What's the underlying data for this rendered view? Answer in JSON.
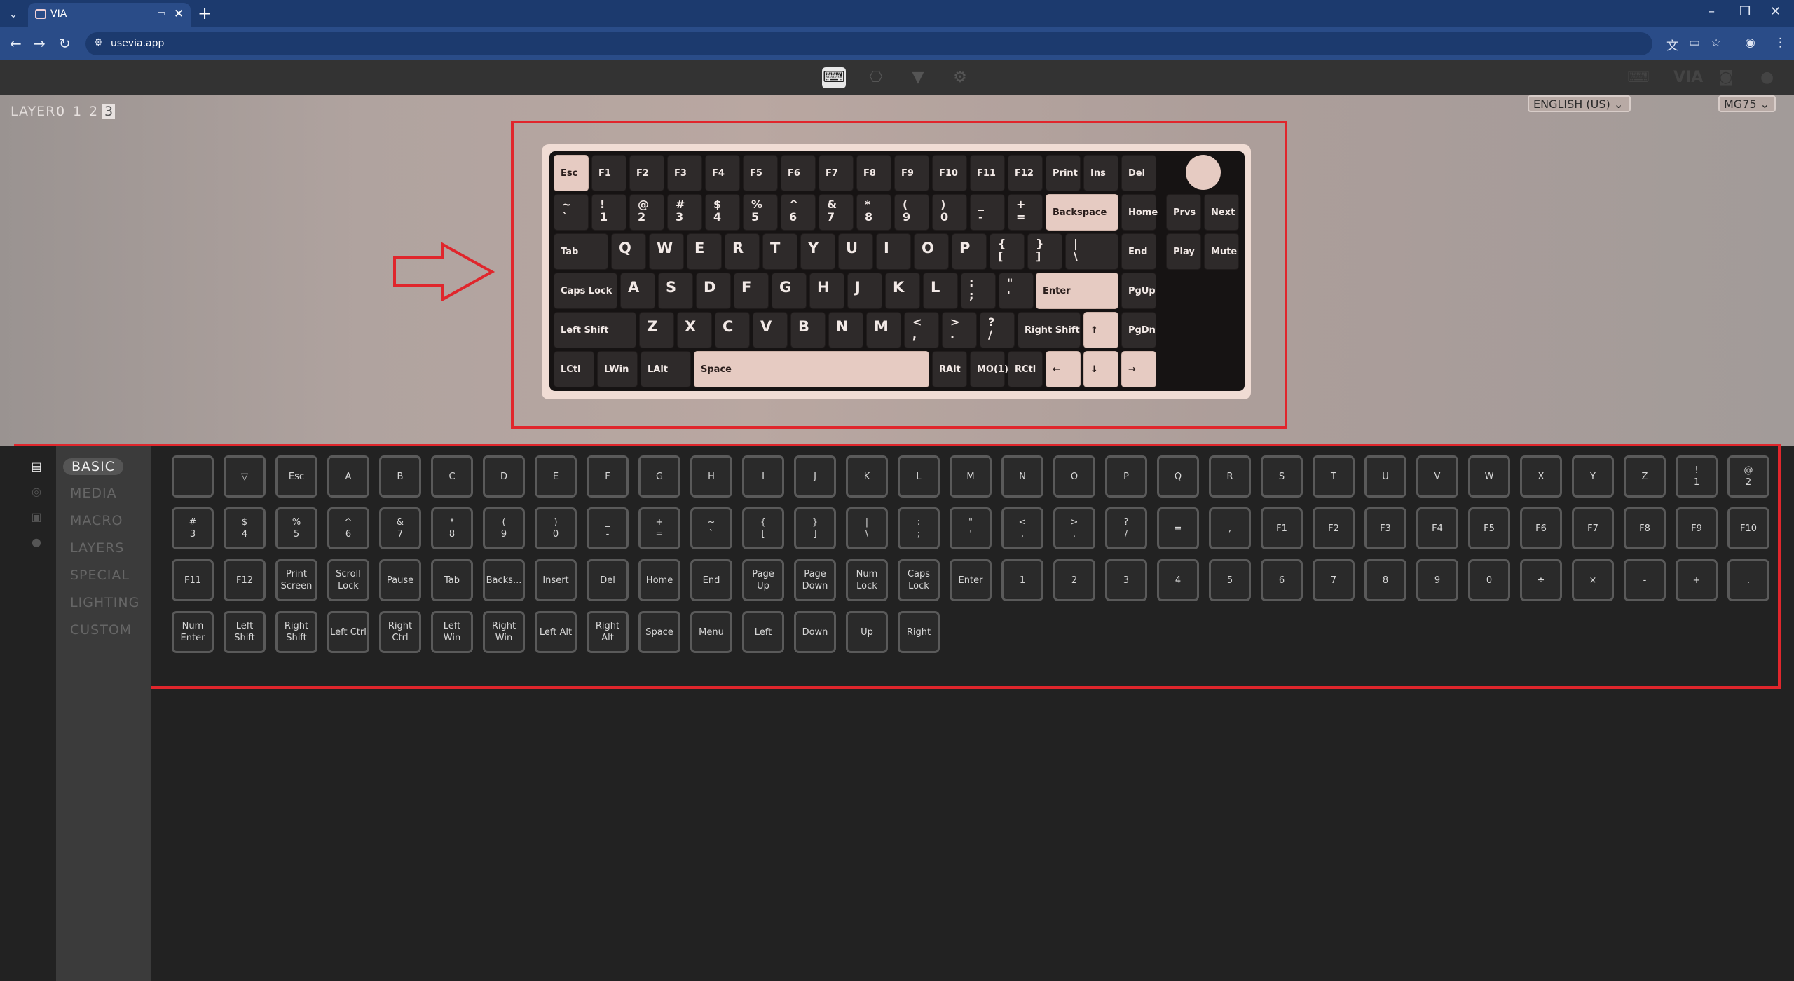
{
  "browser": {
    "tab_title": "VIA",
    "url": "usevia.app",
    "icons": {
      "dropdown": "chevron-down-icon",
      "close": "close-icon",
      "new_tab": "plus-icon",
      "back": "arrow-left-icon",
      "forward": "arrow-right-icon",
      "reload": "reload-icon",
      "site_info": "tune-icon",
      "translate": "translate-icon",
      "install": "install-icon",
      "bookmark": "star-icon",
      "profile": "account-icon",
      "menu": "kebab-menu-icon"
    }
  },
  "via_header": {
    "tabs": [
      "keyboard-icon",
      "test-icon",
      "design-icon",
      "settings-icon"
    ],
    "active_tab": "keyboard-icon",
    "right_icons": [
      "keyboard-lang-icon",
      "via-logo",
      "discord-icon",
      "github-icon"
    ]
  },
  "layer": {
    "label": "LAYER",
    "numbers": [
      "0",
      "1",
      "2",
      "3"
    ],
    "active": "3"
  },
  "selects": {
    "language": "ENGLISH (US) ⌄",
    "keyboard": "MG75 ⌄"
  },
  "keyboard": {
    "rows": [
      [
        {
          "l": "Esc"
        },
        {
          "l": "F1"
        },
        {
          "l": "F2"
        },
        {
          "l": "F3"
        },
        {
          "l": "F4"
        },
        {
          "l": "F5"
        },
        {
          "l": "F6"
        },
        {
          "l": "F7"
        },
        {
          "l": "F8"
        },
        {
          "l": "F9"
        },
        {
          "l": "F10"
        },
        {
          "l": "F11"
        },
        {
          "l": "F12"
        },
        {
          "l": "Print"
        },
        {
          "l": "Ins"
        },
        {
          "l": "Del"
        }
      ],
      [
        {
          "t": "~",
          "b": "`"
        },
        {
          "t": "!",
          "b": "1"
        },
        {
          "t": "@",
          "b": "2"
        },
        {
          "t": "#",
          "b": "3"
        },
        {
          "t": "$",
          "b": "4"
        },
        {
          "t": "%",
          "b": "5"
        },
        {
          "t": "^",
          "b": "6"
        },
        {
          "t": "&",
          "b": "7"
        },
        {
          "t": "*",
          "b": "8"
        },
        {
          "t": "(",
          "b": "9"
        },
        {
          "t": ")",
          "b": "0"
        },
        {
          "t": "_",
          "b": "-"
        },
        {
          "t": "+",
          "b": "="
        },
        {
          "l": "Backspace"
        },
        {
          "l": "Home"
        },
        {
          "l": "Prvs"
        },
        {
          "l": "Next"
        }
      ],
      [
        {
          "l": "Tab"
        },
        {
          "k": "Q"
        },
        {
          "k": "W"
        },
        {
          "k": "E"
        },
        {
          "k": "R"
        },
        {
          "k": "T"
        },
        {
          "k": "Y"
        },
        {
          "k": "U"
        },
        {
          "k": "I"
        },
        {
          "k": "O"
        },
        {
          "k": "P"
        },
        {
          "t": "{",
          "b": "["
        },
        {
          "t": "}",
          "b": "]"
        },
        {
          "t": "|",
          "b": "\\"
        },
        {
          "l": "End"
        },
        {
          "l": "Play"
        },
        {
          "l": "Mute"
        }
      ],
      [
        {
          "l": "Caps Lock"
        },
        {
          "k": "A"
        },
        {
          "k": "S"
        },
        {
          "k": "D"
        },
        {
          "k": "F"
        },
        {
          "k": "G"
        },
        {
          "k": "H"
        },
        {
          "k": "J"
        },
        {
          "k": "K"
        },
        {
          "k": "L"
        },
        {
          "t": ":",
          "b": ";"
        },
        {
          "t": "\"",
          "b": "'"
        },
        {
          "l": "Enter"
        },
        {
          "l": "PgUp"
        }
      ],
      [
        {
          "l": "Left Shift"
        },
        {
          "k": "Z"
        },
        {
          "k": "X"
        },
        {
          "k": "C"
        },
        {
          "k": "V"
        },
        {
          "k": "B"
        },
        {
          "k": "N"
        },
        {
          "k": "M"
        },
        {
          "t": "<",
          "b": ","
        },
        {
          "t": ">",
          "b": "."
        },
        {
          "t": "?",
          "b": "/"
        },
        {
          "l": "Right Shift"
        },
        {
          "l": "↑"
        },
        {
          "l": "PgDn"
        }
      ],
      [
        {
          "l": "LCtl"
        },
        {
          "l": "LWin"
        },
        {
          "l": "LAlt"
        },
        {
          "l": "Space"
        },
        {
          "l": "RAlt"
        },
        {
          "l": "MO(1)"
        },
        {
          "l": "RCtl"
        },
        {
          "l": "←"
        },
        {
          "l": "↓"
        },
        {
          "l": "→"
        }
      ]
    ]
  },
  "sidebar": {
    "icons": [
      "keycaps-icon",
      "media-icon",
      "save-icon",
      "lightbulb-icon"
    ],
    "menu": [
      "BASIC",
      "MEDIA",
      "MACRO",
      "LAYERS",
      "SPECIAL",
      "LIGHTING",
      "CUSTOM"
    ],
    "active": "BASIC"
  },
  "keycodes": [
    [
      "",
      "▽",
      "Esc",
      "A",
      "B",
      "C",
      "D",
      "E",
      "F",
      "G",
      "H",
      "I",
      "J",
      "K",
      "L",
      "M",
      "N",
      "O",
      "P",
      "Q",
      "R",
      "S",
      "T",
      "U",
      "V",
      "W",
      "X",
      "Y",
      "Z",
      "!\n1",
      "@\n2"
    ],
    [
      "#\n3",
      "$\n4",
      "%\n5",
      "^\n6",
      "&\n7",
      "*\n8",
      "(\n9",
      ")\n0",
      "_\n-",
      "+\n=",
      "~\n`",
      "{\n[",
      "}\n]",
      "|\n\\",
      ":\n;",
      "\"\n'",
      "<\n,",
      ">\n.",
      "?\n/",
      "=",
      ",",
      "F1",
      "F2",
      "F3",
      "F4",
      "F5",
      "F6",
      "F7",
      "F8",
      "F9",
      "F10"
    ],
    [
      "F11",
      "F12",
      "Print\nScreen",
      "Scroll\nLock",
      "Pause",
      "Tab",
      "Backs...",
      "Insert",
      "Del",
      "Home",
      "End",
      "Page\nUp",
      "Page\nDown",
      "Num\nLock",
      "Caps\nLock",
      "Enter",
      "1",
      "2",
      "3",
      "4",
      "5",
      "6",
      "7",
      "8",
      "9",
      "0",
      "÷",
      "×",
      "-",
      "+",
      "."
    ],
    [
      "Num\nEnter",
      "Left\nShift",
      "Right\nShift",
      "Left Ctrl",
      "Right\nCtrl",
      "Left\nWin",
      "Right\nWin",
      "Left Alt",
      "Right\nAlt",
      "Space",
      "Menu",
      "Left",
      "Down",
      "Up",
      "Right"
    ]
  ],
  "annotations": {
    "color": "#e0262c"
  }
}
